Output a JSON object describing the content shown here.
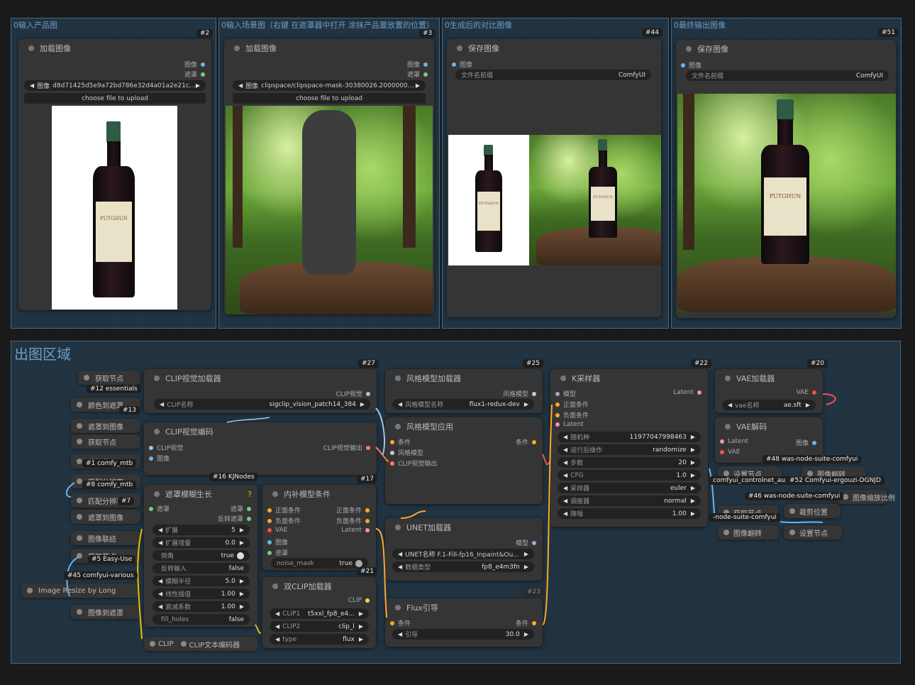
{
  "groups": {
    "g1": "0输入产品图",
    "g2": "0输入场景图（右键 在遮罩器中打开 涂抹产品要放置的位置）",
    "g3": "0生成后的对比图像",
    "g4": "0最终输出图像",
    "region": "出图区域"
  },
  "top_nodes": {
    "load1": {
      "title": "加载图像",
      "id": "#2",
      "out_image": "图像",
      "out_mask": "遮罩",
      "image_label": "图像",
      "image_value": "d8d71425d5e9a72bd786e32d4a01a2e21c...",
      "upload": "choose file to upload"
    },
    "load2": {
      "title": "加载图像",
      "id": "#3",
      "out_image": "图像",
      "out_mask": "遮罩",
      "image_label": "图像",
      "image_value": "clipspace/clipspace-mask-30380026.20000000...",
      "upload": "choose file to upload"
    },
    "save1": {
      "title": "保存图像",
      "id": "#44",
      "in_image": "图像",
      "prefix_label": "文件名前缀",
      "prefix_value": "ComfyUI"
    },
    "save2": {
      "title": "保存图像",
      "id": "#51",
      "in_image": "图像",
      "prefix_label": "文件名前缀",
      "prefix_value": "ComfyUI"
    },
    "bottle_label": "PUTGHUN"
  },
  "side": {
    "items": [
      "获取节点",
      "颜色到遮罩",
      "遮罩到图像",
      "获取节点",
      "获取节点",
      "匹配分辨率",
      "匹配分辨率",
      "遮罩到图像",
      "图像联结",
      "获取节点",
      "Image Resize by Long",
      "图像到遮罩"
    ],
    "badges": [
      "#12 essentials",
      "#13",
      "#1 comfy_mtb",
      "#8 comfy_mtb",
      "#7",
      "#5 Easy-Use",
      "#45 comfyui-various"
    ]
  },
  "clip_vision_loader": {
    "title": "CLIP视觉加载器",
    "id": "#27",
    "out": "CLIP视觉",
    "w_label": "CLIP名称",
    "w_value": "sigclip_vision_patch14_384"
  },
  "clip_vision_encode": {
    "title": "CLIP视觉编码",
    "in1": "CLIP视觉",
    "in2": "图像",
    "out": "CLIP视觉输出",
    "badge": "#16 KJNodes"
  },
  "mask_grow": {
    "title": "遮罩模糊生长",
    "q": "?",
    "in": "遮罩",
    "out1": "遮罩",
    "out2": "反转遮罩",
    "widgets": [
      [
        "扩展",
        "5"
      ],
      [
        "扩展增量",
        "0.0"
      ],
      [
        "倒角",
        "true"
      ],
      [
        "反转输入",
        "false"
      ],
      [
        "模糊半径",
        "5.0"
      ],
      [
        "线性插值",
        "1.00"
      ],
      [
        "衰减系数",
        "1.00"
      ],
      [
        "fill_holes",
        "false"
      ]
    ]
  },
  "inpaint_cond": {
    "title": "内补模型条件",
    "id": "#17",
    "ins": [
      "正面条件",
      "负面条件",
      "VAE",
      "图像",
      "遮罩"
    ],
    "outs": [
      "正面条件",
      "负面条件",
      "Latent"
    ],
    "w_label": "noise_mask",
    "w_value": "true",
    "badge": "#21"
  },
  "dual_clip": {
    "title": "双CLIP加载器",
    "out": "CLIP",
    "widgets": [
      [
        "CLIP1",
        "t5xxl_fp8_e4..."
      ],
      [
        "CLIP2",
        "clip_l"
      ],
      [
        "type",
        "flux"
      ]
    ]
  },
  "clip_text": {
    "t1": "CLIP",
    "t2": "CLIP文本编码器"
  },
  "style_loader": {
    "title": "风格模型加载器",
    "id": "#25",
    "out": "风格模型",
    "w_label": "风格模型名称",
    "w_value": "flux1-redux-dev"
  },
  "style_apply": {
    "title": "风格模型应用",
    "ins": [
      "条件",
      "风格模型",
      "CLIP视觉输出"
    ],
    "out": "条件"
  },
  "unet": {
    "title": "UNET加载器",
    "out": "模型",
    "widgets": [
      [
        "UNET名称",
        "F.1-Fill-fp16_Inpaint&Ou..."
      ],
      [
        "数据类型",
        "fp8_e4m3fn"
      ]
    ],
    "badge": "#23"
  },
  "flux_guide": {
    "title": "Flux引导",
    "in": "条件",
    "out": "条件",
    "w_label": "引导",
    "w_value": "30.0"
  },
  "ksampler": {
    "title": "K采样器",
    "id": "#22",
    "ins": [
      "模型",
      "正面条件",
      "负面条件",
      "Latent"
    ],
    "out": "Latent",
    "widgets": [
      [
        "随机种",
        "1197704799846​3"
      ],
      [
        "运行后操作",
        "randomize"
      ],
      [
        "步数",
        "20"
      ],
      [
        "CFG",
        "1.0"
      ],
      [
        "采样器",
        "euler"
      ],
      [
        "调度器",
        "normal"
      ],
      [
        "降噪",
        "1.00"
      ]
    ]
  },
  "vae_loader": {
    "title": "VAE加载器",
    "id": "#20",
    "out": "VAE",
    "w_label": "vae名称",
    "w_value": "ae.sft"
  },
  "vae_decode": {
    "title": "VAE解码",
    "ins": [
      "Latent",
      "VAE"
    ],
    "out": "图像"
  },
  "right_mini": {
    "items": [
      "设置节点",
      "图像翻转",
      "图像缩放比例",
      "获取节点",
      "裁剪位置",
      "图像翻转",
      "设置节点"
    ],
    "badges": [
      "#48 was-node-suite-comfyui",
      "comfyui_controlnet_aux",
      "#52 Comfyui-ergouzi-DGNJD",
      "#46 was-node-suite-comfyui",
      "-node-suite-comfyui"
    ]
  },
  "colors": {
    "group_border": "#3d6a8a",
    "node_bg": "#353535",
    "image_slot": "#64b5f6",
    "mask_slot": "#81c784",
    "cond_slot": "#ffa726",
    "latent_slot": "#f48fb1",
    "vae_slot": "#ef5350",
    "clip_slot": "#ffd54f"
  }
}
